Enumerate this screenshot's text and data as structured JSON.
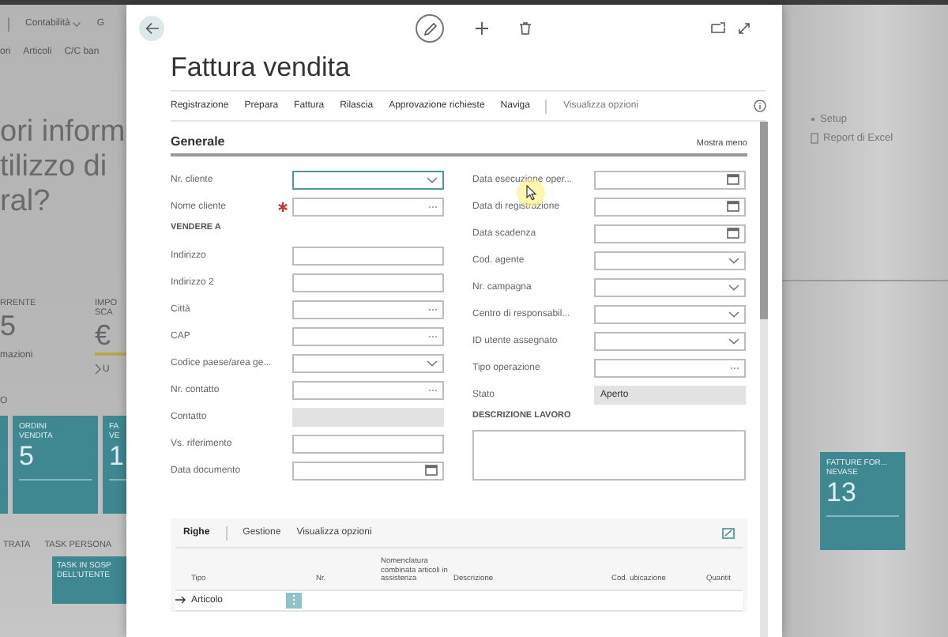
{
  "background": {
    "top_menu": [
      {
        "label": "Contabilità",
        "expandable": true
      },
      {
        "label": "G",
        "expandable": false
      }
    ],
    "nav_links": [
      "ori",
      "Articoli",
      "C/C ban"
    ],
    "headline": [
      "ori inform",
      "tilizzo di",
      "ral?"
    ],
    "kpis": [
      {
        "label": [
          "RRENTE"
        ],
        "value": "5",
        "link": "mazioni",
        "chevron": false,
        "bar": false
      },
      {
        "label": [
          "IMPO",
          "SCA"
        ],
        "value": "€",
        "link": "U",
        "chevron": true,
        "bar": true
      }
    ],
    "group_label": "O",
    "tiles": [
      {
        "title": [
          "ORDINI",
          "VENDITA"
        ],
        "value": "5"
      },
      {
        "title": [
          "FA",
          "VE"
        ],
        "value": "1"
      }
    ],
    "bottom_labels": [
      "TRATA",
      "TASK PERSONA"
    ],
    "bottom_tile": {
      "title": [
        "TASK IN SOSP",
        "DELL'UTENTE"
      ]
    },
    "right_actions": [
      {
        "label": "Setup",
        "kind": "dot"
      },
      {
        "label": "Report di Excel",
        "kind": "sheet"
      }
    ],
    "right_tile": {
      "title": [
        "FATTURE FOR...",
        "NEVASE"
      ],
      "value": "13"
    }
  },
  "dialog": {
    "title": "Fattura vendita",
    "actions": [
      "Registrazione",
      "Prepara",
      "Fattura",
      "Rilascia",
      "Approvazione richieste",
      "Naviga"
    ],
    "view_options": "Visualizza opzioni",
    "section": {
      "title": "Generale",
      "toggle": "Mostra meno"
    },
    "left_fields": [
      {
        "kind": "dropdown",
        "label": "Nr. cliente",
        "focused": true,
        "required": false
      },
      {
        "kind": "lookup",
        "label": "Nome cliente",
        "focused": false,
        "required": true
      },
      {
        "kind": "heading",
        "label": "VENDERE A"
      },
      {
        "kind": "text",
        "label": "Indirizzo",
        "focused": false,
        "required": false
      },
      {
        "kind": "text",
        "label": "Indirizzo 2",
        "focused": false,
        "required": false
      },
      {
        "kind": "lookup",
        "label": "Città",
        "focused": false,
        "required": false
      },
      {
        "kind": "lookup",
        "label": "CAP",
        "focused": false,
        "required": false
      },
      {
        "kind": "dropdown",
        "label": "Codice paese/area ge...",
        "focused": false,
        "required": false
      },
      {
        "kind": "lookup",
        "label": "Nr. contatto",
        "focused": false,
        "required": false
      },
      {
        "kind": "readonly",
        "label": "Contatto",
        "focused": false,
        "required": false
      },
      {
        "kind": "text",
        "label": "Vs. riferimento",
        "focused": false,
        "required": false
      },
      {
        "kind": "date",
        "label": "Data documento",
        "focused": false,
        "required": false
      }
    ],
    "right_fields": [
      {
        "kind": "date",
        "label": "Data esecuzione oper...",
        "focused": false,
        "required": false
      },
      {
        "kind": "date",
        "label": "Data di registrazione",
        "focused": false,
        "required": false
      },
      {
        "kind": "date",
        "label": "Data scadenza",
        "focused": false,
        "required": false
      },
      {
        "kind": "dropdown",
        "label": "Cod. agente",
        "focused": false,
        "required": false
      },
      {
        "kind": "dropdown",
        "label": "Nr. campagna",
        "focused": false,
        "required": false
      },
      {
        "kind": "dropdown",
        "label": "Centro di responsabil...",
        "focused": false,
        "required": false
      },
      {
        "kind": "dropdown",
        "label": "ID utente assegnato",
        "focused": false,
        "required": false
      },
      {
        "kind": "lookup",
        "label": "Tipo operazione",
        "focused": false,
        "required": false
      },
      {
        "kind": "readonly",
        "label": "Stato",
        "value": "Aperto",
        "focused": false,
        "required": false
      },
      {
        "kind": "heading",
        "label": "DESCRIZIONE LAVORO"
      },
      {
        "kind": "textarea"
      }
    ],
    "lines": {
      "tabs": [
        {
          "label": "Righe",
          "selected": true
        },
        {
          "label": "Gestione",
          "selected": false
        },
        {
          "label": "Visualizza opzioni",
          "selected": false
        }
      ],
      "columns": [
        "Tipo",
        "Nr.",
        "Nomenclatura combinata articoli in assistenza",
        "Descrizione",
        "Cod. ubicazione",
        "Quantit"
      ],
      "rows": [
        {
          "current": true,
          "tipo": "Articolo"
        }
      ]
    }
  }
}
